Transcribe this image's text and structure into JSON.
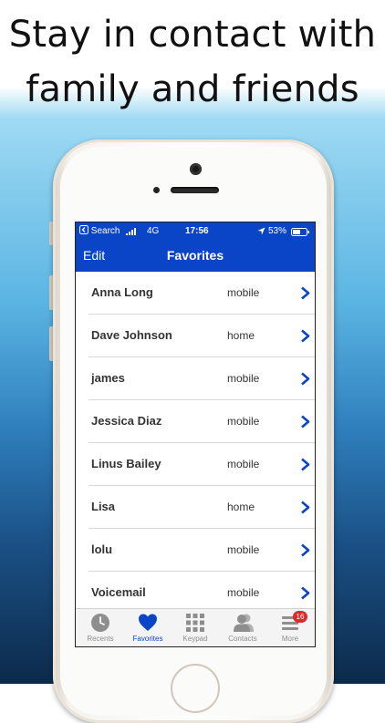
{
  "promo": {
    "line1": "Stay in contact with",
    "line2": "family and friends"
  },
  "status_bar": {
    "back_label": "Search",
    "network": "4G",
    "time": "17:56",
    "battery": "53%"
  },
  "nav": {
    "edit_label": "Edit",
    "title": "Favorites"
  },
  "favorites": [
    {
      "name": "Anna Long",
      "type": "mobile"
    },
    {
      "name": "Dave Johnson",
      "type": "home"
    },
    {
      "name": "james",
      "type": "mobile"
    },
    {
      "name": "Jessica Diaz",
      "type": "mobile"
    },
    {
      "name": "Linus Bailey",
      "type": "mobile"
    },
    {
      "name": "Lisa",
      "type": "home"
    },
    {
      "name": "lolu",
      "type": "mobile"
    },
    {
      "name": "Voicemail",
      "type": "mobile"
    }
  ],
  "tabs": [
    {
      "label": "Recents",
      "icon": "clock-icon"
    },
    {
      "label": "Favorites",
      "icon": "heart-icon"
    },
    {
      "label": "Keypad",
      "icon": "keypad-icon"
    },
    {
      "label": "Contacts",
      "icon": "contacts-icon"
    },
    {
      "label": "More",
      "icon": "menu-icon",
      "badge": "16"
    }
  ],
  "colors": {
    "accent": "#0a45c8",
    "badge": "#e0282d",
    "chevron": "#0a45c8"
  }
}
